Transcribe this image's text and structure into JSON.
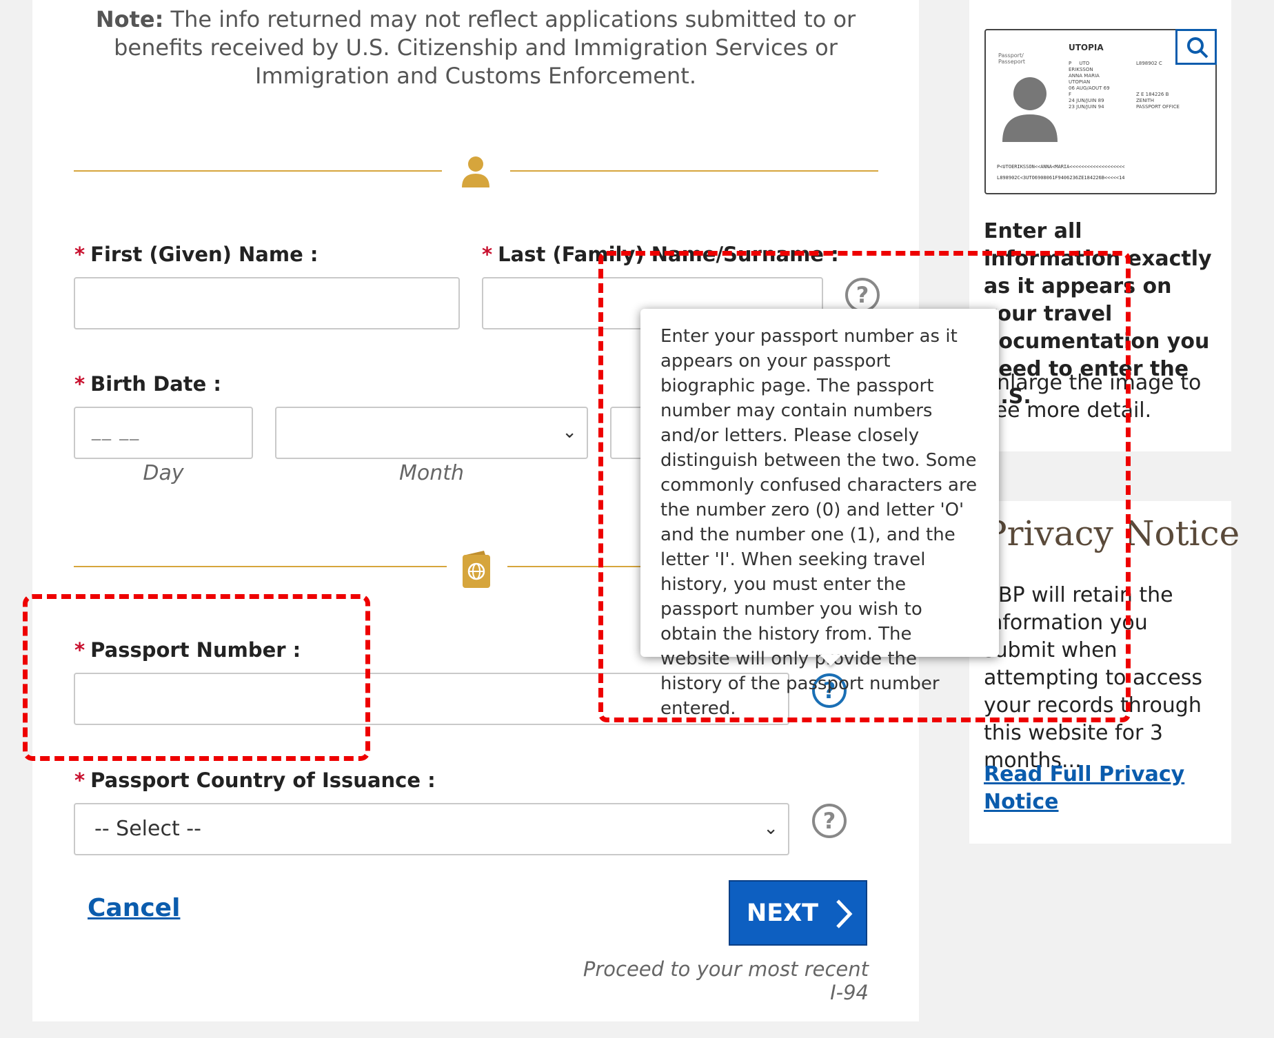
{
  "note": {
    "bold": "Note:",
    "text": " The info returned may not reflect applications submitted to or benefits received by U.S. Citizenship and Immigration Services or Immigration and Customs Enforcement."
  },
  "form": {
    "first_name_label": "First (Given) Name :",
    "last_name_label": "Last (Family) Name/Surname :",
    "birth_date_label": "Birth Date :",
    "day_placeholder": "__ __",
    "day_sublabel": "Day",
    "month_sublabel": "Month",
    "passport_number_label": "Passport Number :",
    "country_label": "Passport Country of Issuance :",
    "country_selected": "-- Select --",
    "required_mark": "*",
    "help_glyph": "?"
  },
  "tooltip": {
    "text": "Enter your passport number as it appears on your passport biographic page. The passport number may contain numbers and/or letters. Please closely distinguish between the two. Some commonly confused characters are the number zero (0) and letter 'O' and the number one (1), and the letter 'I'. When seeking travel history, you must enter the passport number you wish to obtain the history from. The website will only provide the history of the passport number entered."
  },
  "actions": {
    "cancel": "Cancel",
    "next": "NEXT",
    "proceed": "Proceed to your most recent I-94"
  },
  "sidebar": {
    "passport_image": {
      "country": "UTOPIA",
      "doc_label": "Passport/ Passeport",
      "type": "P",
      "code": "UTO",
      "number": "L898902 C",
      "surname": "ERIKSSON",
      "given": "ANNA MARIA",
      "nationality": "UTOPIAN",
      "dob": "06 AUG/AOUT 69",
      "personal_no": "Z E 184226 B",
      "sex": "F",
      "place": "ZENITH",
      "issue": "24 JUN/JUIN 89",
      "authority": "PASSPORT OFFICE",
      "expiry": "23 JUN/JUIN 94",
      "mrz1": "P<UTOERIKSSON<<ANNA<MARIA<<<<<<<<<<<<<<<<<<<",
      "mrz2": "L898902C<3UTO6908061F9406236ZE184226B<<<<<14"
    },
    "info_bold": "Enter all information exactly as it appears on your travel documentation you need to enter the U.S.",
    "enlarge": "Enlarge the image to see more detail.",
    "privacy_title": "Privacy Notice",
    "privacy_text": "CBP will retain the information you submit when attempting to access your records through this website for 3 months...",
    "privacy_link": "Read Full Privacy Notice"
  },
  "colors": {
    "accent_gold": "#d6a53c",
    "primary_blue": "#0d5fc1",
    "required_red": "#c8102e",
    "annotation_red": "#ee0000"
  }
}
